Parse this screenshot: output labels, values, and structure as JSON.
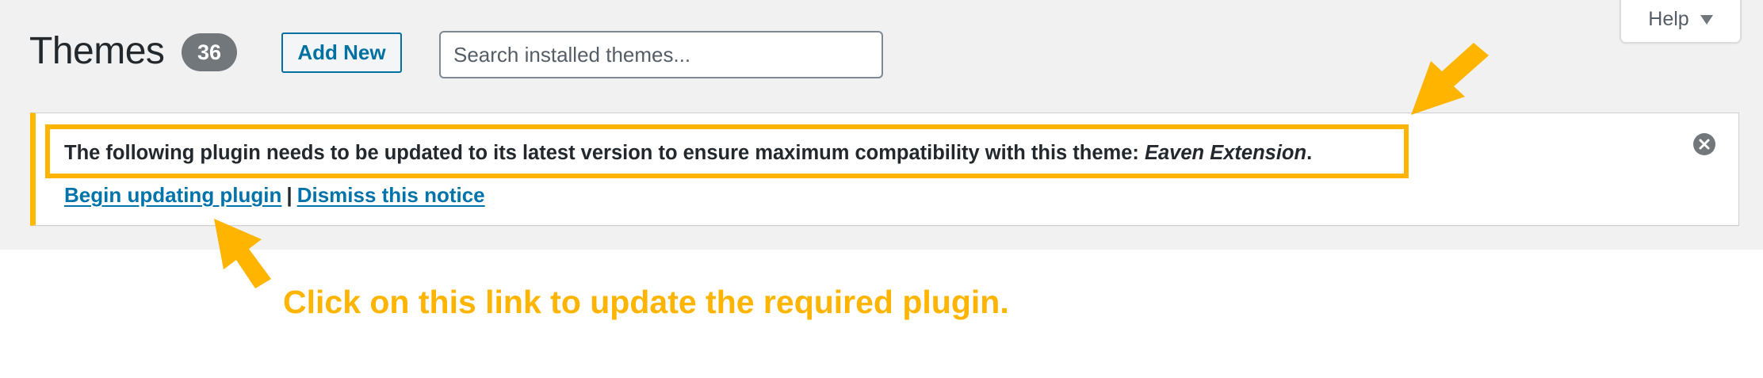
{
  "header": {
    "title": "Themes",
    "count": "36",
    "add_new_label": "Add New",
    "help_label": "Help"
  },
  "search": {
    "placeholder": "Search installed themes...",
    "value": ""
  },
  "notice": {
    "message_prefix": "The following plugin needs to be updated to its latest version to ensure maximum compatibility with this theme: ",
    "plugin_name": "Eaven Extension",
    "message_suffix": ".",
    "begin_link": "Begin updating plugin",
    "separator": "|",
    "dismiss_link": "Dismiss this notice"
  },
  "annotation": {
    "text": "Click on this link to update the required plugin.",
    "color": "#ffb400"
  },
  "colors": {
    "accent": "#0073aa",
    "warning": "#ffb900",
    "badge": "#72777c"
  },
  "icons": {
    "dismiss": "close-circle-icon",
    "help_caret": "caret-down-icon",
    "arrow": "arrow-icon"
  }
}
